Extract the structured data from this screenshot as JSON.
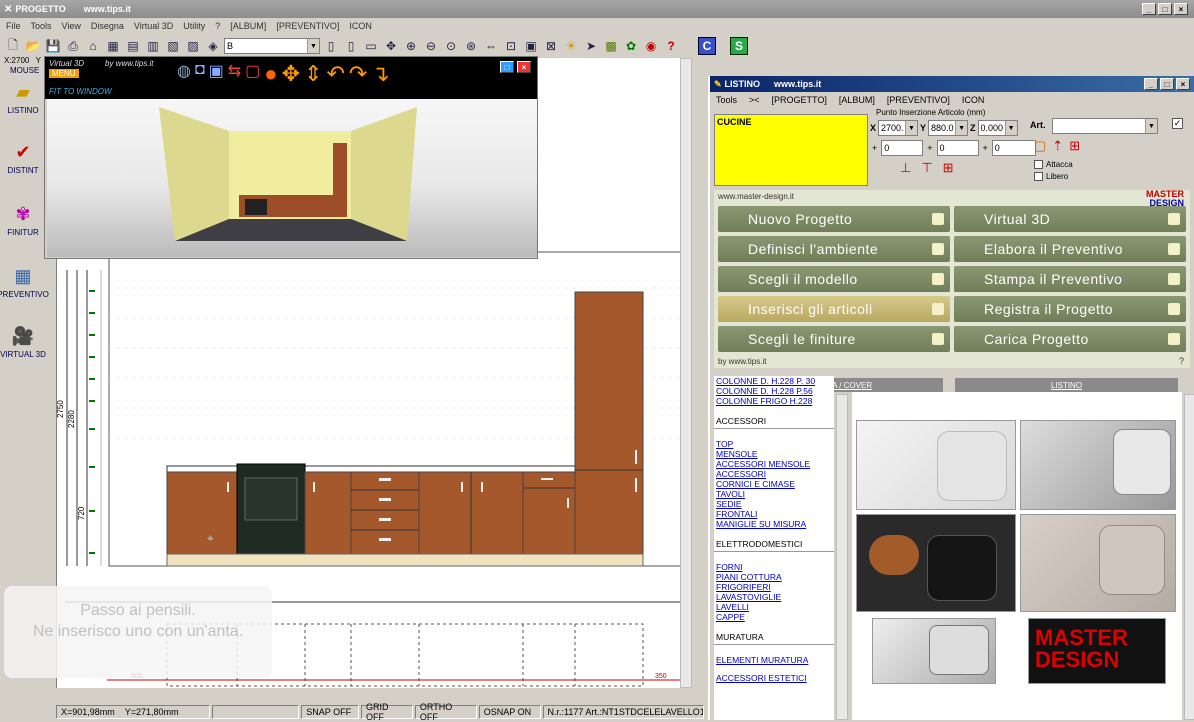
{
  "window": {
    "title": "PROGETTO",
    "url": "www.tips.it"
  },
  "menubar": [
    "File",
    "Tools",
    "View",
    "Disegna",
    "Virtual 3D",
    "Utility",
    "?",
    "[ALBUM]",
    "[PREVENTIVO]",
    "ICON"
  ],
  "toolbar": {
    "layer_combo": "B",
    "badge_c": "C",
    "badge_s": "S"
  },
  "coords_label": "X:2700",
  "coords_label2": "Y",
  "mouse_label": "MOUSE",
  "left_tools": [
    {
      "label": "LISTINO",
      "icon": "list-icon"
    },
    {
      "label": "DISTINT",
      "icon": "checklist-icon"
    },
    {
      "label": "FINITUR",
      "icon": "palette-icon"
    },
    {
      "label": "PREVENTIVO",
      "icon": "calculator-icon"
    },
    {
      "label": "VIRTUAL 3D",
      "icon": "camera-icon"
    }
  ],
  "v3d": {
    "title": "Virtual 3D",
    "by": "by www.tips.it",
    "menu": "MENU",
    "fit": "FIT TO WINDOW"
  },
  "drawing": {
    "dim_2750": "2750",
    "dim_2280": "2280",
    "dim_720": "720",
    "dim_600": "600",
    "dim_350": "350",
    "marker": "C"
  },
  "note": "Passo ai pensili.\nNe inserisco uno con un'anta.",
  "statusbar": {
    "x": "X=901,98mm",
    "y": "Y=271,80mm",
    "snap": "SNAP OFF",
    "grid": "GRID OFF",
    "ortho": "ORTHO OFF",
    "osnap": "OSNAP ON",
    "info": "N.r.:1177 Art.:NT1STDCELELAVELLO1\\"
  },
  "listino": {
    "title": "LISTINO",
    "url": "www.tips.it",
    "menu": [
      "Tools",
      "><",
      "[PROGETTO]",
      "[ALBUM]",
      "[PREVENTIVO]",
      "ICON"
    ],
    "category": "CUCINE",
    "insert_label": "Punto Inserzione Articolo (mm)",
    "x_label": "X",
    "x_val": "2700.",
    "y_label": "Y",
    "y_val": "880.0",
    "z_label": "Z",
    "z_val": "0.000",
    "off1": "0",
    "off2": "0",
    "off3": "0",
    "art_label": "Art.",
    "attacca": "Attacca",
    "libero": "Libero",
    "md_url": "www.master-design.it",
    "md_logo1": "MASTER",
    "md_logo2": "DESIGN",
    "md_by": "by www.tips.it",
    "md_help": "?",
    "buttons_left": [
      "Nuovo Progetto",
      "Definisci l'ambiente",
      "Scegli il modello",
      "Inserisci gli articoli",
      "Scegli le finiture"
    ],
    "buttons_right": [
      "Virtual 3D",
      "Elabora il Preventivo",
      "Stampa il Preventivo",
      "Registra il Progetto",
      "Carica Progetto"
    ],
    "tab1": "COPERTINA / COVER",
    "tab2": "LISTINO",
    "cat_top": [
      "COLONNE D. H.228 P. 30",
      "COLONNE D. H.228 P.56",
      "COLONNE FRIGO H.228"
    ],
    "cat_acc_head": "ACCESSORI",
    "cat_acc": [
      "TOP",
      "MENSOLE",
      "ACCESSORI MENSOLE",
      "ACCESSORI",
      "CORNICI E CIMASE",
      "TAVOLI",
      "SEDIE",
      "FRONTALI",
      "MANIGLIE SU MISURA"
    ],
    "cat_el_head": "ELETTRODOMESTICI",
    "cat_el": [
      "FORNI",
      "PIANI COTTURA",
      "FRIGORIFERI",
      "LAVASTOVIGLIE",
      "LAVELLI",
      "CAPPE"
    ],
    "cat_mu_head": "MURATURA",
    "cat_mu": [
      "ELEMENTI MURATURA"
    ],
    "cat_last": "ACCESSORI ESTETICI",
    "logo_master": "MASTER",
    "logo_design": "DESIGN"
  }
}
